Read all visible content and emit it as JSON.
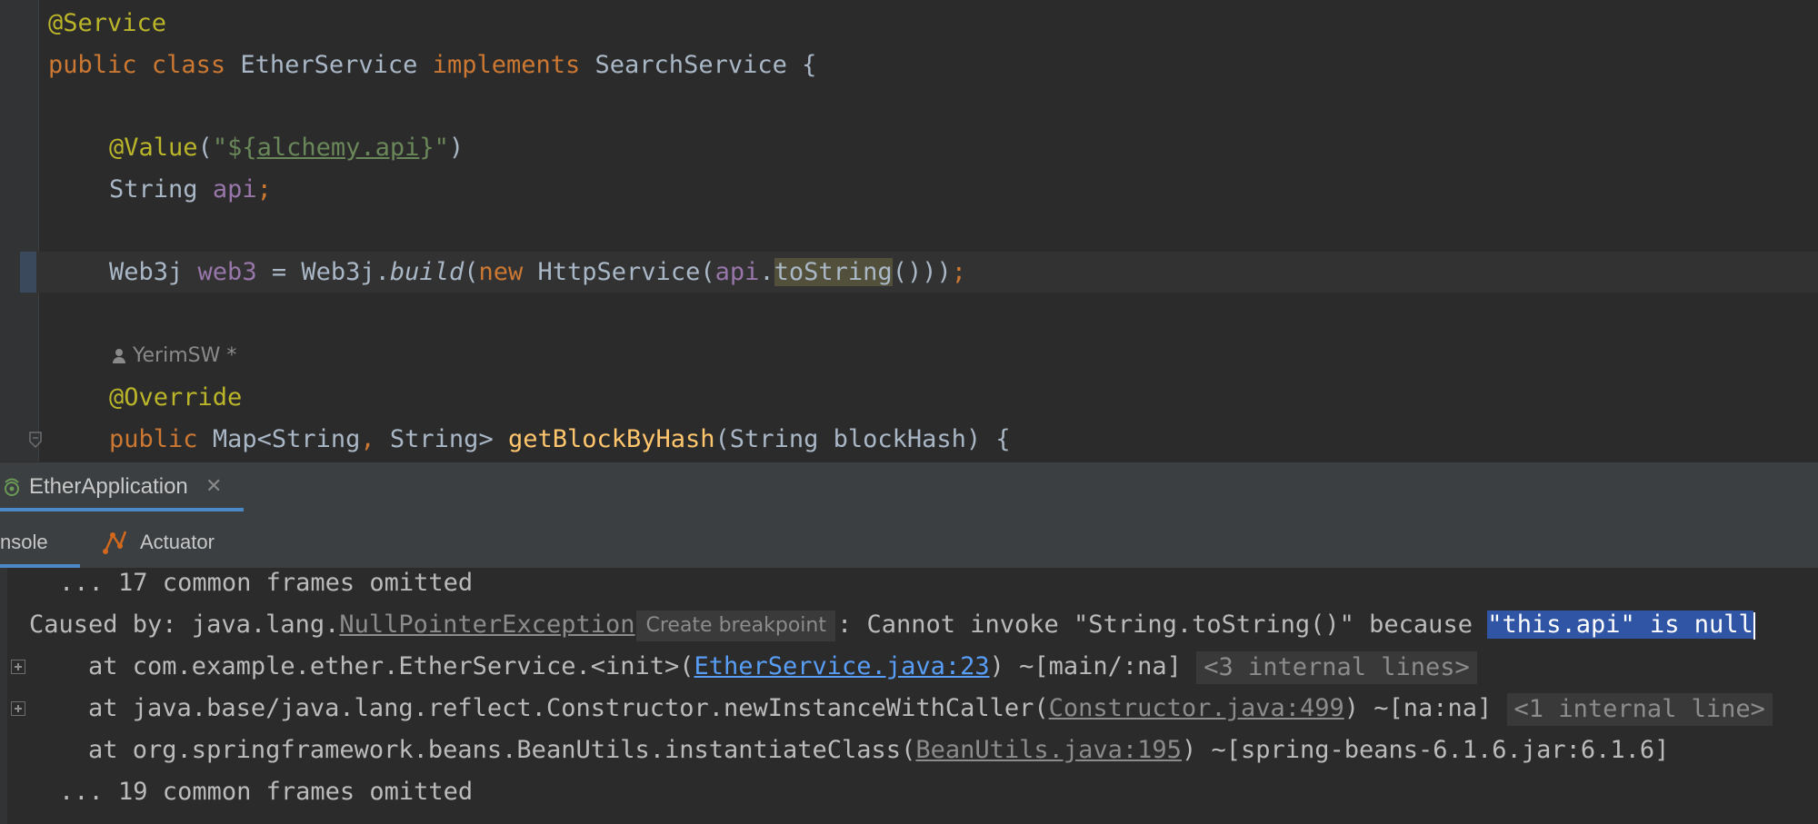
{
  "editor": {
    "line1": "@Service",
    "line2": {
      "kw1": "public",
      "kw2": "class",
      "name": "EtherService",
      "kw3": "implements",
      "iface": "SearchService",
      "brace": "{"
    },
    "line3": {
      "ann": "@Value",
      "open": "(",
      "q1": "\"${",
      "prop": "alchemy.api",
      "q2": "}\"",
      "close": ")"
    },
    "line4": {
      "type": "String",
      "field": "api",
      "semi": ";"
    },
    "line5": {
      "type": "Web3j",
      "field": "web3",
      "eq": "=",
      "cls": "Web3j.",
      "method": "build",
      "open": "(",
      "kw": "new",
      "ctor": "HttpService(",
      "arg": "api",
      "dot": ".",
      "call": "toString",
      "rest": "()))",
      "semi": ";"
    },
    "author": "YerimSW *",
    "line6": "@Override",
    "line7": {
      "kw": "public",
      "type": "Map<String",
      "comma": ",",
      "type2": "String>",
      "method": "getBlockByHash",
      "params": "(String blockHash) {"
    }
  },
  "run_panel": {
    "tab_title": "EtherApplication",
    "close_glyph": "✕",
    "subtab_console": "nsole",
    "subtab_actuator": "Actuator"
  },
  "console": {
    "line1": "    ... 17 common frames omitted",
    "line2": {
      "prefix": "Caused by: java.lang.",
      "exception": "NullPointerException",
      "chip": "Create breakpoint",
      "msg": ": Cannot invoke \"String.toString()\" because ",
      "selected": "\"this.api\" is null"
    },
    "line3": {
      "prefix": "    at com.example.ether.EtherService.<init>(",
      "link": "EtherService.java:23",
      "suffix": ") ~[main/:na] ",
      "chip": "<3 internal lines>"
    },
    "line4": {
      "prefix": "    at java.base/java.lang.reflect.Constructor.newInstanceWithCaller(",
      "link": "Constructor.java:499",
      "suffix": ") ~[na:na] ",
      "chip": "<1 internal line>"
    },
    "line5": {
      "prefix": "    at org.springframework.beans.BeanUtils.instantiateClass(",
      "link": "BeanUtils.java:195",
      "suffix": ") ~[spring-beans-6.1.6.jar:6.1.6]"
    },
    "line6": "    ... 19 common frames omitted"
  },
  "icons": [
    "user-icon",
    "fold-icon",
    "run-config-icon",
    "close-icon",
    "actuator-icon",
    "expand-icon"
  ],
  "colors": {
    "keyword": "#cc7832",
    "annotation": "#bbb529",
    "string": "#6a8759",
    "field": "#9876aa",
    "method": "#ffc66d",
    "link": "#589df6",
    "selection": "#2f55a4",
    "tab_accent": "#4a88c7"
  }
}
